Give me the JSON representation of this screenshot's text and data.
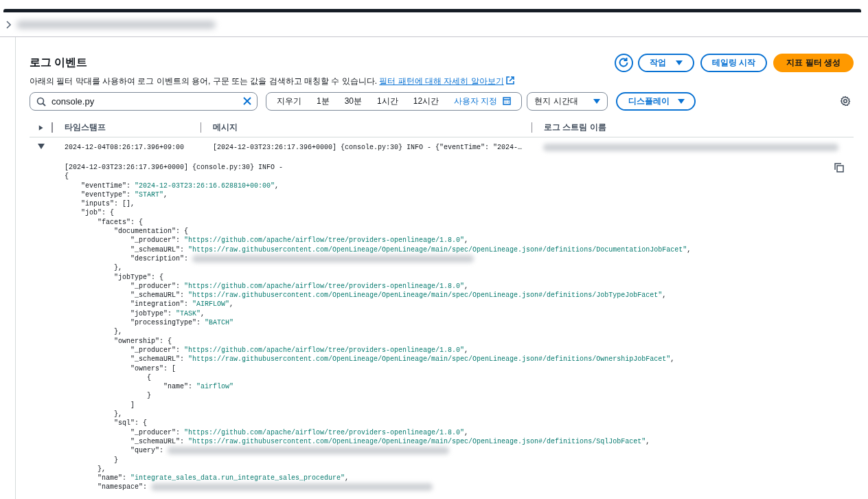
{
  "panel": {
    "title": "로그 이벤트",
    "description": "아래의 필터 막대를 사용하여 로그 이벤트의 용어, 구문 또는 값을 검색하고 매칭할 수 있습니다.",
    "help_link": "필터 패턴에 대해 자세히 알아보기"
  },
  "actions": [
    {
      "label": "작업",
      "kind": "dropdown"
    },
    {
      "label": "테일링 시작",
      "kind": "normal"
    },
    {
      "label": "지표 필터 생성",
      "kind": "primary"
    }
  ],
  "search": {
    "value": "console.py"
  },
  "time_ranges": [
    {
      "label": "지우기",
      "kind": "preset"
    },
    {
      "label": "1분",
      "kind": "preset"
    },
    {
      "label": "30분",
      "kind": "preset"
    },
    {
      "label": "1시간",
      "kind": "preset"
    },
    {
      "label": "12시간",
      "kind": "preset"
    },
    {
      "label": "사용자 지정",
      "kind": "custom"
    }
  ],
  "timezone": {
    "label": "현지 시간대"
  },
  "display": {
    "label": "디스플레이"
  },
  "table": {
    "columns": [
      "타임스탬프",
      "메시지",
      "로그 스트림 이름"
    ],
    "rows": [
      {
        "expanded": true,
        "timestamp": "2024-12-04T08:26:17.396+09:00",
        "message": "[2024-12-03T23:26:17.396+0000] {console.py:30} INFO - {\"eventTime\": \"2024-…",
        "detail": [
          [
            {
              "kind": "plain",
              "text": "[2024-12-03T23:26:17.396+0000] {console.py:30} INFO -"
            }
          ],
          [
            {
              "kind": "plain",
              "text": "{"
            }
          ],
          [
            {
              "kind": "plain",
              "text": "    \"eventTime\": "
            },
            {
              "kind": "string",
              "text": "\"2024-12-03T23:26:16.628810+00:00\""
            },
            {
              "kind": "plain",
              "text": ","
            }
          ],
          [
            {
              "kind": "plain",
              "text": "    \"eventType\": "
            },
            {
              "kind": "string",
              "text": "\"START\""
            },
            {
              "kind": "plain",
              "text": ","
            }
          ],
          [
            {
              "kind": "plain",
              "text": "    \"inputs\": [],"
            }
          ],
          [
            {
              "kind": "plain",
              "text": "    \"job\": {"
            }
          ],
          [
            {
              "kind": "plain",
              "text": "        \"facets\": {"
            }
          ],
          [
            {
              "kind": "plain",
              "text": "            \"documentation\": {"
            }
          ],
          [
            {
              "kind": "plain",
              "text": "                \"_producer\": "
            },
            {
              "kind": "string",
              "text": "\"https://github.com/apache/airflow/tree/providers-openlineage/1.8.0\""
            },
            {
              "kind": "plain",
              "text": ","
            }
          ],
          [
            {
              "kind": "plain",
              "text": "                \"_schemaURL\": "
            },
            {
              "kind": "string",
              "text": "\"https://raw.githubusercontent.com/OpenLineage/OpenLineage/main/spec/OpenLineage.json#/definitions/DocumentationJobFacet\""
            },
            {
              "kind": "plain",
              "text": ","
            }
          ],
          [
            {
              "kind": "plain",
              "text": "                \"description\": "
            },
            {
              "kind": "redacted"
            }
          ],
          [
            {
              "kind": "plain",
              "text": "            },"
            }
          ],
          [
            {
              "kind": "plain",
              "text": "            \"jobType\": {"
            }
          ],
          [
            {
              "kind": "plain",
              "text": "                \"_producer\": "
            },
            {
              "kind": "string",
              "text": "\"https://github.com/apache/airflow/tree/providers-openlineage/1.8.0\""
            },
            {
              "kind": "plain",
              "text": ","
            }
          ],
          [
            {
              "kind": "plain",
              "text": "                \"_schemaURL\": "
            },
            {
              "kind": "string",
              "text": "\"https://raw.githubusercontent.com/OpenLineage/OpenLineage/main/spec/OpenLineage.json#/definitions/JobTypeJobFacet\""
            },
            {
              "kind": "plain",
              "text": ","
            }
          ],
          [
            {
              "kind": "plain",
              "text": "                \"integration\": "
            },
            {
              "kind": "string",
              "text": "\"AIRFLOW\""
            },
            {
              "kind": "plain",
              "text": ","
            }
          ],
          [
            {
              "kind": "plain",
              "text": "                \"jobType\": "
            },
            {
              "kind": "string",
              "text": "\"TASK\""
            },
            {
              "kind": "plain",
              "text": ","
            }
          ],
          [
            {
              "kind": "plain",
              "text": "                \"processingType\": "
            },
            {
              "kind": "string",
              "text": "\"BATCH\""
            }
          ],
          [
            {
              "kind": "plain",
              "text": "            },"
            }
          ],
          [
            {
              "kind": "plain",
              "text": "            \"ownership\": {"
            }
          ],
          [
            {
              "kind": "plain",
              "text": "                \"_producer\": "
            },
            {
              "kind": "string",
              "text": "\"https://github.com/apache/airflow/tree/providers-openlineage/1.8.0\""
            },
            {
              "kind": "plain",
              "text": ","
            }
          ],
          [
            {
              "kind": "plain",
              "text": "                \"_schemaURL\": "
            },
            {
              "kind": "string",
              "text": "\"https://raw.githubusercontent.com/OpenLineage/OpenLineage/main/spec/OpenLineage.json#/definitions/OwnershipJobFacet\""
            },
            {
              "kind": "plain",
              "text": ","
            }
          ],
          [
            {
              "kind": "plain",
              "text": "                \"owners\": ["
            }
          ],
          [
            {
              "kind": "plain",
              "text": "                    {"
            }
          ],
          [
            {
              "kind": "plain",
              "text": "                        \"name\": "
            },
            {
              "kind": "string",
              "text": "\"airflow\""
            }
          ],
          [
            {
              "kind": "plain",
              "text": "                    }"
            }
          ],
          [
            {
              "kind": "plain",
              "text": "                ]"
            }
          ],
          [
            {
              "kind": "plain",
              "text": "            },"
            }
          ],
          [
            {
              "kind": "plain",
              "text": "            \"sql\": {"
            }
          ],
          [
            {
              "kind": "plain",
              "text": "                \"_producer\": "
            },
            {
              "kind": "string",
              "text": "\"https://github.com/apache/airflow/tree/providers-openlineage/1.8.0\""
            },
            {
              "kind": "plain",
              "text": ","
            }
          ],
          [
            {
              "kind": "plain",
              "text": "                \"_schemaURL\": "
            },
            {
              "kind": "string",
              "text": "\"https://raw.githubusercontent.com/OpenLineage/OpenLineage/main/spec/OpenLineage.json#/definitions/SqlJobFacet\""
            },
            {
              "kind": "plain",
              "text": ","
            }
          ],
          [
            {
              "kind": "plain",
              "text": "                \"query\": "
            },
            {
              "kind": "redacted"
            }
          ],
          [
            {
              "kind": "plain",
              "text": "            }"
            }
          ],
          [
            {
              "kind": "plain",
              "text": "        },"
            }
          ],
          [
            {
              "kind": "plain",
              "text": "        \"name\": "
            },
            {
              "kind": "string",
              "text": "\"integrate_sales_data.run_integrate_sales_procedure\""
            },
            {
              "kind": "plain",
              "text": ","
            }
          ],
          [
            {
              "kind": "plain",
              "text": "        \"namespace\": "
            },
            {
              "kind": "redacted"
            }
          ]
        ]
      }
    ]
  }
}
